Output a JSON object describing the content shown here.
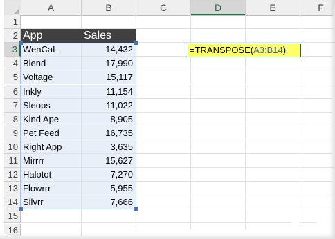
{
  "columns": [
    {
      "id": "A",
      "label": "A"
    },
    {
      "id": "B",
      "label": "B"
    },
    {
      "id": "C",
      "label": "C"
    },
    {
      "id": "D",
      "label": "D",
      "active": true
    },
    {
      "id": "E",
      "label": "E"
    },
    {
      "id": "F",
      "label": "F"
    }
  ],
  "row_numbers": [
    "1",
    "2",
    "3",
    "4",
    "5",
    "6",
    "7",
    "8",
    "9",
    "10",
    "11",
    "12",
    "13",
    "14",
    "15",
    "16"
  ],
  "active_row": "3",
  "table": {
    "header": {
      "app": "App",
      "sales": "Sales"
    },
    "rows": [
      {
        "app": "WenCaL",
        "sales": "14,432"
      },
      {
        "app": "Blend",
        "sales": "17,990"
      },
      {
        "app": "Voltage",
        "sales": "15,117"
      },
      {
        "app": "Inkly",
        "sales": "11,154"
      },
      {
        "app": "Sleops",
        "sales": "11,022"
      },
      {
        "app": "Kind Ape",
        "sales": "8,905"
      },
      {
        "app": "Pet Feed",
        "sales": "16,735"
      },
      {
        "app": "Right App",
        "sales": "3,635"
      },
      {
        "app": "Mirrrr",
        "sales": "15,627"
      },
      {
        "app": "Halotot",
        "sales": "7,270"
      },
      {
        "app": "Flowrrr",
        "sales": "5,955"
      },
      {
        "app": "Silvrr",
        "sales": "7,666"
      }
    ]
  },
  "formula": {
    "cell": "D3",
    "prefix": "=TRANSPOSE(",
    "range_ref": "A3:B14",
    "suffix": ")"
  },
  "colors": {
    "header_fill": "#404040",
    "selection_fill": "#e9eff8",
    "range_border": "#4472c4",
    "formula_fill": "#ffff66",
    "active_accent": "#217346",
    "ref_text": "#3f61c9"
  }
}
